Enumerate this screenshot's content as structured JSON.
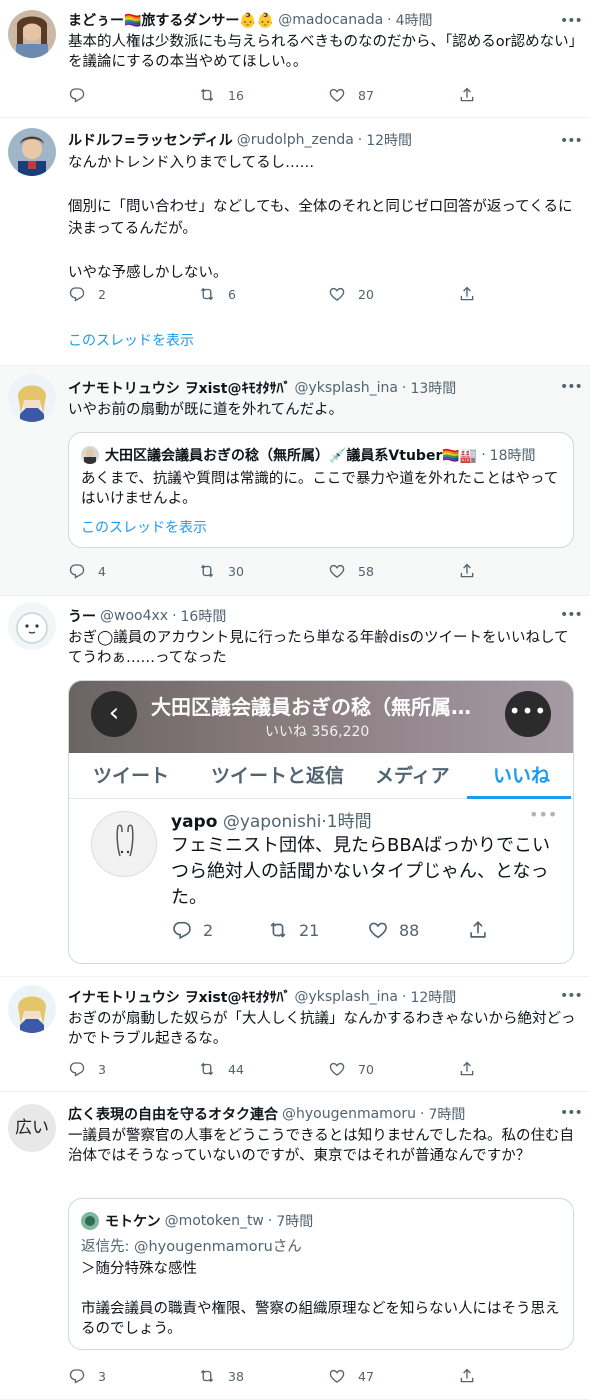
{
  "tweets": [
    {
      "name": "まどぅー🏳️‍🌈旅するダンサー👶👶",
      "handle": "@madocanada",
      "dot": "·",
      "time": "4時間",
      "text": "基本的人権は少数派にも与えられるべきものなのだから、「認めるor認めない」を議論にするの本当やめてほしい。。",
      "reply": "",
      "retweet": "16",
      "like": "87"
    },
    {
      "name": "ルドルフ=ラッセンディル",
      "handle": "@rudolph_zenda",
      "dot": "·",
      "time": "12時間",
      "text": "なんかトレンド入りまでしてるし……\n\n個別に「問い合わせ」などしても、全体のそれと同じゼロ回答が返ってくるに決まってるんだが。\n\nいやな予感しかしない。",
      "reply": "2",
      "retweet": "6",
      "like": "20",
      "show_thread": "このスレッドを表示"
    },
    {
      "name": "イナモトリュウシ ヲxist@ｷﾓｵﾀｻﾊﾞ",
      "handle": "@yksplash_ina",
      "dot": "·",
      "time": "13時間",
      "text": "いやお前の扇動が既に道を外れてんだよ。",
      "reply": "4",
      "retweet": "30",
      "like": "58",
      "quote": {
        "name": "大田区議会議員おぎの稔（無所属）💉議員系Vtuber🏳️‍🌈🏭",
        "dot": "·",
        "time": "18時間",
        "text": "あくまで、抗議や質問は常識的に。ここで暴力や道を外れたことはやってはいけませんよ。",
        "show_thread": "このスレッドを表示"
      }
    },
    {
      "name": "うー",
      "handle": "@woo4xx",
      "dot": "·",
      "time": "16時間",
      "text": "おぎ◯議員のアカウント見に行ったら単なる年齢disのツイートをいいねしててうわぁ……ってなった",
      "screenshot": {
        "title": "大田区議会議員おぎの稔（無所属…",
        "likes_count": "いいね 356,220",
        "tabs": [
          "ツイート",
          "ツイートと返信",
          "メディア",
          "いいね"
        ],
        "back": "‹",
        "menu": "•••",
        "tweet_name": "yapo",
        "tweet_handle": "@yaponishi",
        "tweet_dot": "·",
        "tweet_time": "1時間",
        "tweet_dots": "•••",
        "tweet_text": "フェミニスト団体、見たらBBAばっかりでこいつら絶対人の話聞かないタイプじゃん、となった。",
        "reply": "2",
        "retweet": "21",
        "like": "88"
      }
    },
    {
      "name": "イナモトリュウシ ヲxist@ｷﾓｵﾀｻﾊﾞ",
      "handle": "@yksplash_ina",
      "dot": "·",
      "time": "12時間",
      "text": "おぎのが扇動した奴らが「大人しく抗議」なんかするわきゃないから絶対どっかでトラブル起きるな。",
      "reply": "3",
      "retweet": "44",
      "like": "70"
    },
    {
      "name": "広く表現の自由を守るオタク連合",
      "handle": "@hyougenmamoru",
      "dot": "·",
      "time": "7時間",
      "avatar_text": "広い",
      "text": "一議員が警察官の人事をどうこうできるとは知りませんでしたね。私の住む自治体ではそうなっていないのですが、東京ではそれが普通なんですか？",
      "reply": "3",
      "retweet": "38",
      "like": "47",
      "quote": {
        "name": "モトケン",
        "handle": "@motoken_tw",
        "dot": "·",
        "time": "7時間",
        "reply_to": "返信先: @hyougenmamoruさん",
        "text": "＞随分特殊な感性\n\n市議会議員の職責や権限、警察の組織原理などを知らない人にはそう思えるのでしょう。"
      }
    }
  ],
  "more_icon": "•••",
  "colors": {
    "accent": "#1d9bf0",
    "secondary_text": "#536471",
    "border": "#eff3f4",
    "highlight_bg": "#f7f9f9"
  }
}
